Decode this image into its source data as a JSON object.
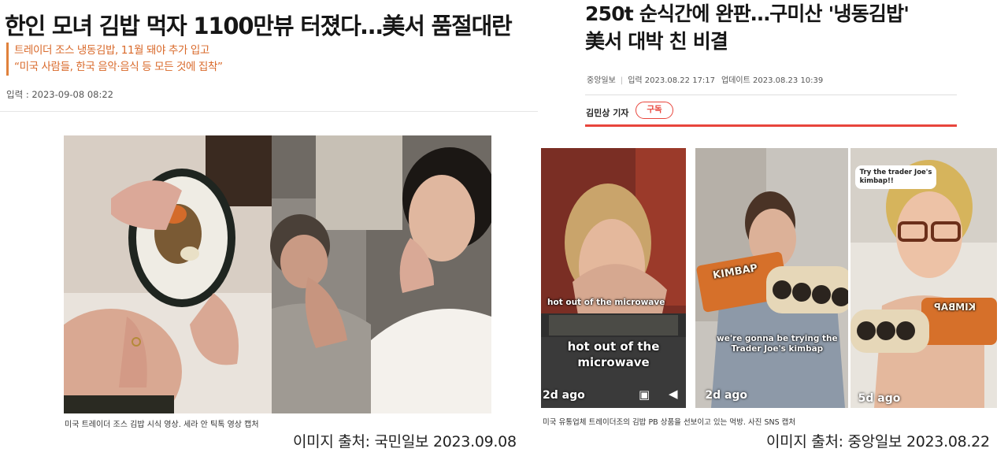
{
  "left_article": {
    "headline": "한인 모녀 김밥 먹자 1100만뷰 터졌다…美서 품절대란",
    "subheadlines": [
      "트레이더 조스 냉동김밥, 11월 돼야 추가 입고",
      "“미국 사람들, 한국 음악·음식 등 모든 것에 집착”"
    ],
    "date_label": "입력 : 2023-09-08 08:22",
    "photo_caption": "미국 트레이더 조스 김밥 시식 영상. 세라 안 틱톡 영상 캡처",
    "source_label": "이미지 출처:  국민일보 2023.09.08"
  },
  "right_article": {
    "headline_line1": "250t 순식간에 완판…구미산 '냉동김밥'",
    "headline_line2": "美서 대박 친 비결",
    "publisher": "중앙일보",
    "published": "입력 2023.08.22 17:17",
    "updated": "업데이트 2023.08.23 10:39",
    "reporter": "김민상 기자",
    "subscribe_label": "구독",
    "photo_caption": "미국 유통업체 트레이더조의 김밥 PB 상품을 선보이고 있는 먹방. 사진 SNS 캡처",
    "source_label": "이미지 출처:  중앙일보 2023.08.22",
    "panels": [
      {
        "small_caption": "hot out of the microwave",
        "big_caption_1": "hot out of the",
        "big_caption_2": "microwave",
        "ago": "2d ago"
      },
      {
        "package_label": "KIMBAP",
        "caption_1": "we're gonna be trying the",
        "caption_2": "Trader Joe's kimbap",
        "ago": "2d ago"
      },
      {
        "bubble": "Try the trader Joe's\nkimbap!!",
        "package_label": "KIMBAP",
        "ago": "5d ago"
      }
    ]
  },
  "colors": {
    "accent_orange": "#d9692a",
    "accent_red": "#e8453c"
  }
}
